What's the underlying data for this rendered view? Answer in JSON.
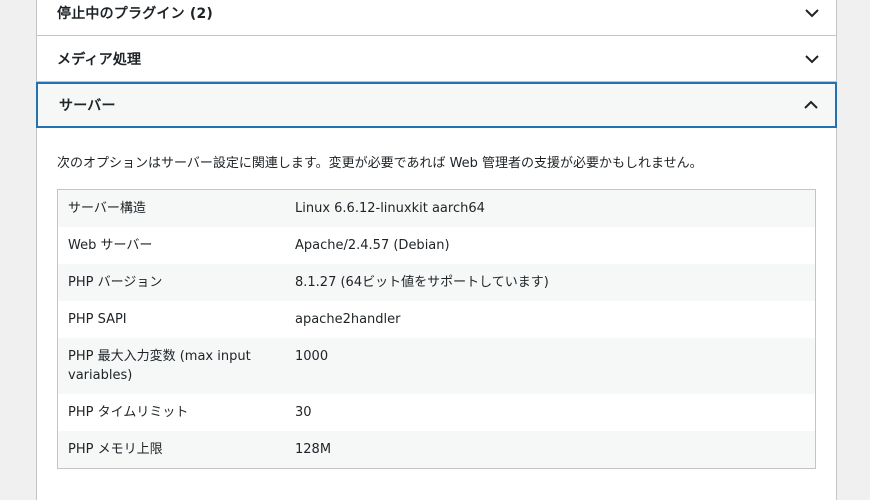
{
  "sections": {
    "inactive_plugins": {
      "label": "停止中のプラグイン (2)"
    },
    "media": {
      "label": "メディア処理"
    },
    "server": {
      "label": "サーバー"
    }
  },
  "server_panel": {
    "description": "次のオプションはサーバー設定に関連します。変更が必要であれば Web 管理者の支援が必要かもしれません。",
    "rows": [
      {
        "key": "サーバー構造",
        "value": "Linux 6.6.12-linuxkit aarch64"
      },
      {
        "key": "Web サーバー",
        "value": "Apache/2.4.57 (Debian)"
      },
      {
        "key": "PHP バージョン",
        "value": "8.1.27 (64ビット値をサポートしています)"
      },
      {
        "key": "PHP SAPI",
        "value": "apache2handler"
      },
      {
        "key": "PHP 最大入力変数 (max input variables)",
        "value": "1000"
      },
      {
        "key": "PHP タイムリミット",
        "value": "30"
      },
      {
        "key": "PHP メモリ上限",
        "value": "128M"
      }
    ]
  }
}
